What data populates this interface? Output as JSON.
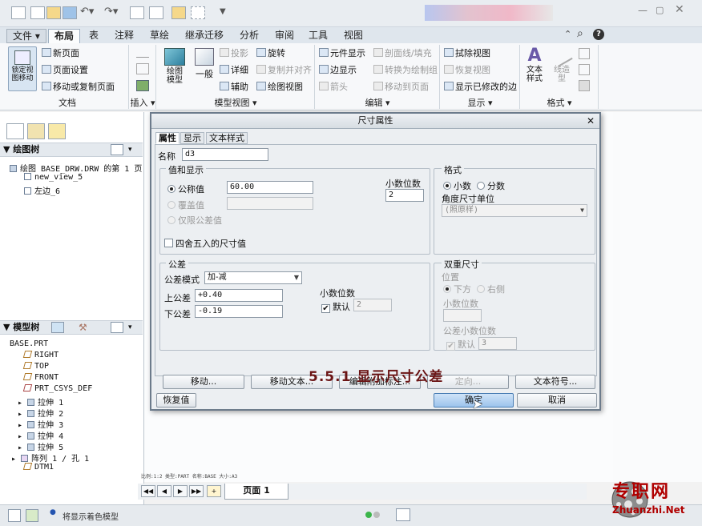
{
  "ribbon_tabs": [
    "文件",
    "布局",
    "表",
    "注释",
    "草绘",
    "继承迁移",
    "分析",
    "审阅",
    "工具",
    "视图"
  ],
  "ribbon": {
    "lock_view_move": "锁定视\n图移动",
    "new_page": "新页面",
    "page_setup": "页面设置",
    "move_copy_page": "移动或复制页面",
    "drawing_model": "绘图\n模型",
    "general": "一般",
    "projection": "投影",
    "detail": "详细",
    "auxiliary": "辅助",
    "rotate": "旋转",
    "copy_align": "复制并对齐",
    "drawing_view": "绘图视图",
    "element_display": "元件显示",
    "edge_display": "边显示",
    "arrow": "箭头",
    "section_line_fill": "剖面线/填充",
    "convert_to_sketch_group": "转换为绘制组",
    "move_to_page": "移动到页面",
    "erase_view": "拭除视图",
    "restore_view": "恢复视图",
    "show_modified_edges": "显示已修改的边",
    "text_style": "文本\n样式",
    "line_style": "线造\n型",
    "groups": {
      "document": "文档",
      "insert": "插入",
      "model_view": "模型视图",
      "edit": "编辑",
      "display": "显示",
      "format": "格式"
    }
  },
  "drawing_tree": {
    "title": "绘图树",
    "root": "绘图 BASE_DRW.DRW 的第 1 页",
    "items": [
      "new_view_5",
      "左边_6"
    ]
  },
  "model_tree": {
    "title": "模型树",
    "root": "BASE.PRT",
    "items": [
      "RIGHT",
      "TOP",
      "FRONT",
      "PRT_CSYS_DEF",
      "拉伸 1",
      "拉伸 2",
      "拉伸 3",
      "拉伸 4",
      "拉伸 5",
      "阵列 1 / 孔 1",
      "DTM1"
    ]
  },
  "dialog": {
    "title": "尺寸属性",
    "tabs": [
      "属性",
      "显示",
      "文本样式"
    ],
    "name_label": "名称",
    "name_value": "d3",
    "value_group": "值和显示",
    "nominal_label": "公称值",
    "nominal_value": "60.00",
    "override_label": "覆盖值",
    "tolerance_only_label": "仅限公差值",
    "decimals_label": "小数位数",
    "decimals_value": "2",
    "round_label": "四舍五入的尺寸值",
    "format_group": "格式",
    "format_decimal": "小数",
    "format_fraction": "分数",
    "angle_unit_label": "角度尺寸单位",
    "angle_unit_value": "(照原样)",
    "tolerance_group": "公差",
    "tol_mode_label": "公差模式",
    "tol_mode_value": "加-减",
    "upper_label": "上公差",
    "upper_value": "+0.40",
    "lower_label": "下公差",
    "lower_value": "-0.19",
    "tol_decimals_label": "小数位数",
    "default_label": "默认",
    "tol_decimals_value": "2",
    "dual_group": "双重尺寸",
    "position_label": "位置",
    "below_label": "下方",
    "right_label": "右侧",
    "dual_decimals_label": "小数位数",
    "dual_tol_decimals_label": "公差小数位数",
    "dual_default_label": "默认",
    "dual_default_value": "3",
    "btn_move": "移动...",
    "btn_move_text": "移动文本...",
    "btn_edit_attach": "编辑附加标注...",
    "btn_orient": "定向...",
    "btn_text_symbol": "文本符号...",
    "btn_restore": "恢复值",
    "btn_ok": "确定",
    "btn_cancel": "取消"
  },
  "overlay_caption": "5.5.1  显示尺寸公差",
  "canvas_status": "比例:1:2    类型:PART  名称:BASE  大小:A3",
  "page_tab": "页面 1",
  "status_message": "将显示着色模型",
  "watermark": {
    "cn": "专职网",
    "en": "Zhuanzhi.Net"
  },
  "colors": {
    "accent": "#4c7fb5",
    "caption": "#6b1515",
    "watermark": "#b00000"
  }
}
